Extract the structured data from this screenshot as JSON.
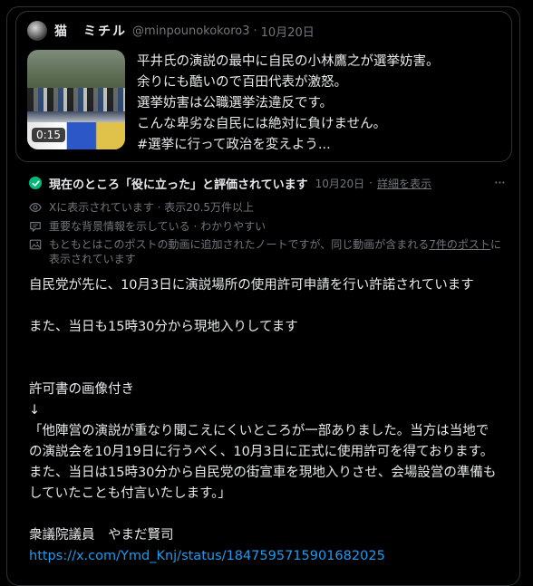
{
  "quote": {
    "display_name": "猫　ミチル",
    "handle": "@minpounokokoro3",
    "dot": "·",
    "date": "10月20日",
    "video_duration": "0:15",
    "text_lines": [
      "平井氏の演説の最中に自民の小林鷹之が選挙妨害。",
      "余りにも酷いので百田代表が激怒。",
      "選挙妨害は公職選挙法違反です。",
      "こんな卑劣な自民には絶対に負けません。",
      "#選挙に行って政治を変えよう..."
    ]
  },
  "note": {
    "title": "現在のところ「役に立った」と評価されています",
    "date": "10月20日",
    "separator": "·",
    "details_link": "詳細を表示",
    "more_label": "···",
    "views_text": "Xに表示されています · 表示20.5万件以上",
    "context_text": "重要な背景情報を示している · わかりやすい",
    "media_text_before": "もともとはこのポストの動画に追加されたノートですが、同じ動画が含まれる",
    "media_link": "7件のポスト",
    "media_text_after": "に表示されています",
    "body": {
      "line1": "自民党が先に、10月3日に演説場所の使用許可申請を行い許諾されています",
      "line2": "また、当日も15時30分から現地入りしてます",
      "line3": "許可書の画像付き",
      "arrow": "↓",
      "quote_line1": "「他陣営の演説が重なり聞こえにくいところが一部ありました。当方は当地で",
      "quote_line2": "の演説会を10月19日に行うべく、10月3日に正式に使用許可を得ております。",
      "quote_line3": "また、当日は15時30分から自民党の街宣車を現地入りさせ、会場設営の準備も",
      "quote_line4": "していたことも付言いたします。」",
      "signature": "衆議院議員　やまだ賢司",
      "link": "https://x.com/Ymd_Knj/status/1847595715901682025"
    }
  }
}
